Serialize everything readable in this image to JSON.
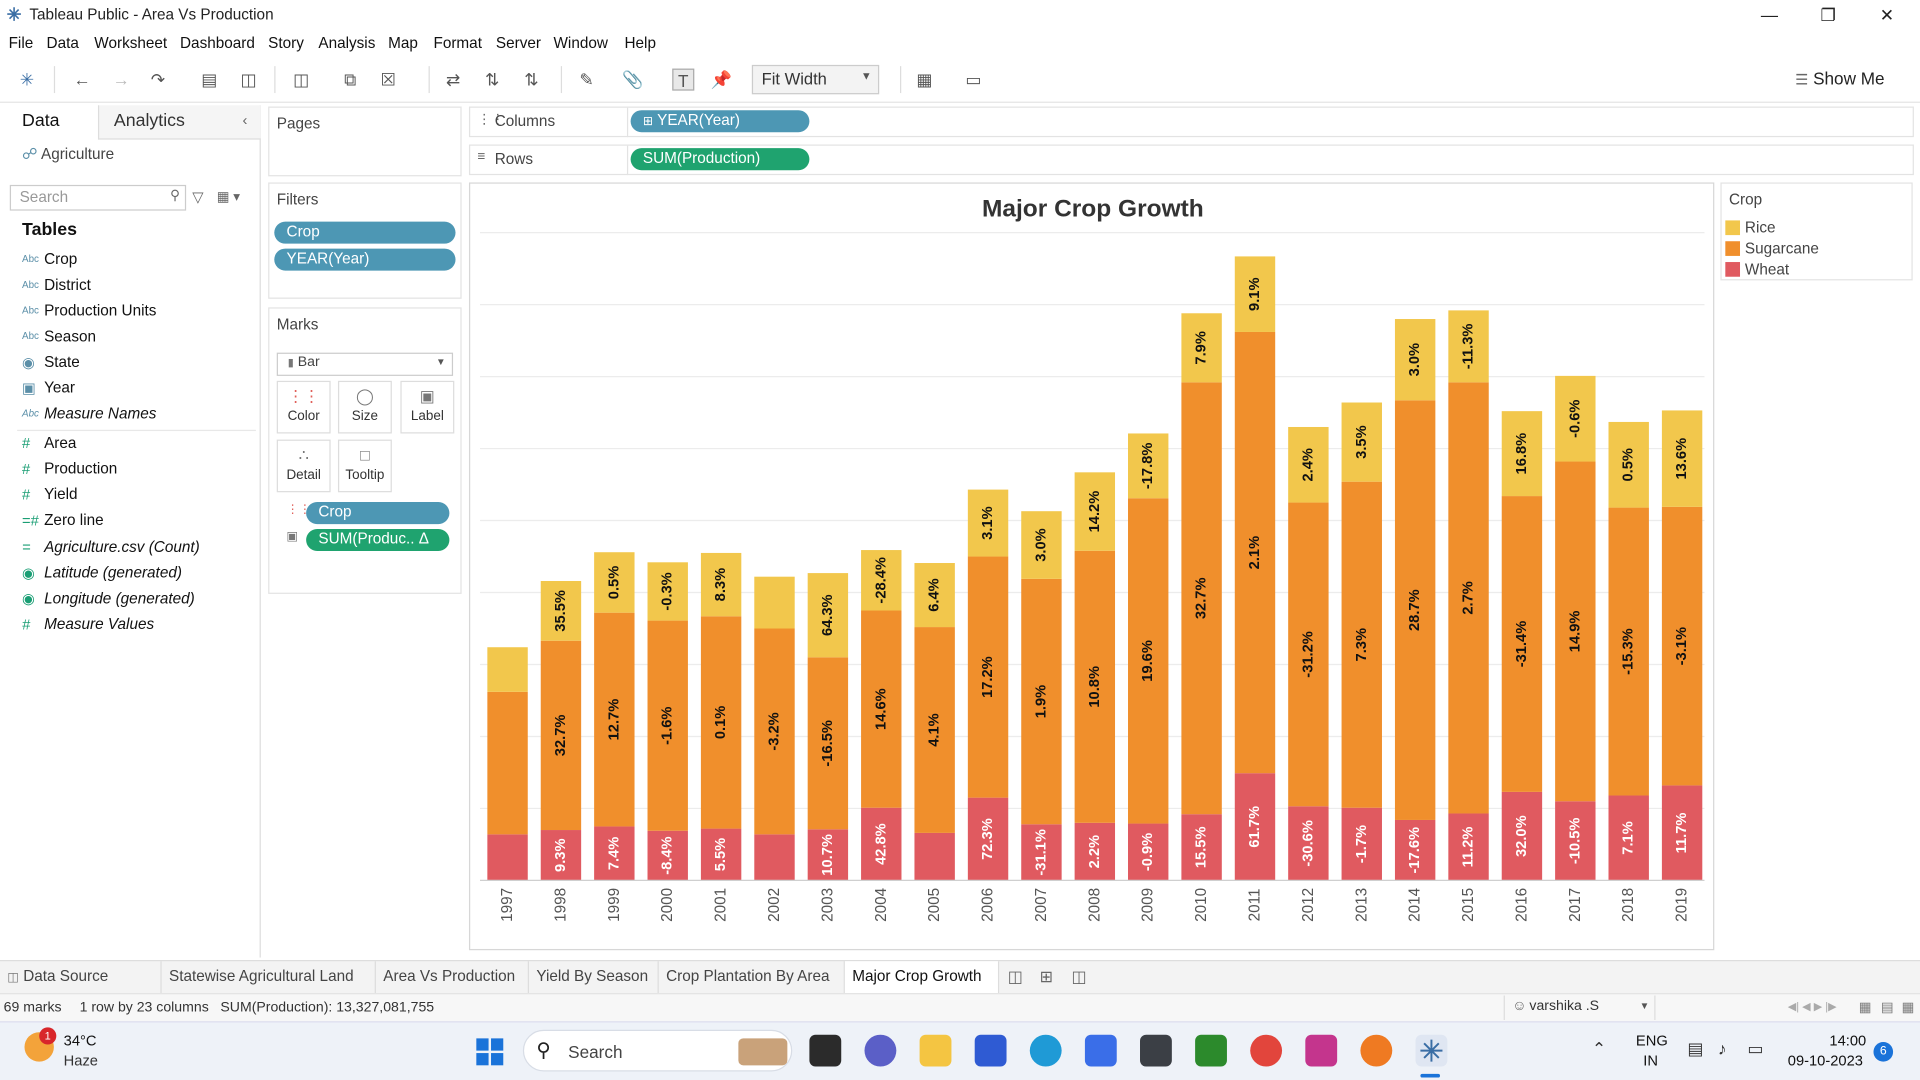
{
  "window": {
    "title": "Tableau Public - Area Vs Production"
  },
  "menu": [
    "File",
    "Data",
    "Worksheet",
    "Dashboard",
    "Story",
    "Analysis",
    "Map",
    "Format",
    "Server",
    "Window",
    "Help"
  ],
  "toolbar": {
    "fit": "Fit Width",
    "show_me": "Show Me"
  },
  "data_pane": {
    "tab_data": "Data",
    "tab_analytics": "Analytics",
    "datasource": "Agriculture",
    "search_placeholder": "Search",
    "tables_heading": "Tables",
    "dimensions": [
      {
        "icon": "Abc",
        "label": "Crop"
      },
      {
        "icon": "Abc",
        "label": "District"
      },
      {
        "icon": "Abc",
        "label": "Production Units"
      },
      {
        "icon": "Abc",
        "label": "Season"
      },
      {
        "icon": "globe",
        "label": "State"
      },
      {
        "icon": "calendar",
        "label": "Year"
      },
      {
        "icon": "Abc",
        "label": "Measure Names"
      }
    ],
    "measures": [
      {
        "label": "Area"
      },
      {
        "label": "Production"
      },
      {
        "label": "Yield"
      },
      {
        "label": "Zero line"
      },
      {
        "label": "Agriculture.csv (Count)"
      },
      {
        "label": "Latitude (generated)"
      },
      {
        "label": "Longitude (generated)"
      },
      {
        "label": "Measure Values"
      }
    ]
  },
  "pages": {
    "label": "Pages"
  },
  "filters": {
    "label": "Filters",
    "items": [
      "Crop",
      "YEAR(Year)"
    ]
  },
  "marks": {
    "label": "Marks",
    "type": "Bar",
    "buttons": [
      "Color",
      "Size",
      "Label",
      "Detail",
      "Tooltip"
    ],
    "pills": [
      "Crop",
      "SUM(Produc.. Δ"
    ]
  },
  "shelves": {
    "columns_label": "Columns",
    "columns_pill": "YEAR(Year)",
    "rows_label": "Rows",
    "rows_pill": "SUM(Production)"
  },
  "legend": {
    "title": "Crop",
    "items": [
      {
        "name": "Rice",
        "color": "#f2c74c"
      },
      {
        "name": "Sugarcane",
        "color": "#f08f2c"
      },
      {
        "name": "Wheat",
        "color": "#e05a60"
      }
    ]
  },
  "chart_data": {
    "type": "bar",
    "stacked": true,
    "title": "Major Crop Growth",
    "categories": [
      "1997",
      "1998",
      "1999",
      "2000",
      "2001",
      "2002",
      "2003",
      "2004",
      "2005",
      "2006",
      "2007",
      "2008",
      "2009",
      "2010",
      "2011",
      "2012",
      "2013",
      "2014",
      "2015",
      "2016",
      "2017",
      "2018",
      "2019"
    ],
    "series": [
      {
        "name": "Wheat",
        "color": "#e05a60",
        "values": [
          0.64,
          0.7,
          0.75,
          0.69,
          0.72,
          0.64,
          0.71,
          1.01,
          0.66,
          1.15,
          0.78,
          0.8,
          0.79,
          0.92,
          1.49,
          1.03,
          1.01,
          0.84,
          0.93,
          1.23,
          1.1,
          1.18,
          1.32
        ],
        "labels": [
          "",
          "9.3%",
          "7.4%",
          "-8.4%",
          "5.5%",
          "",
          "10.7%",
          "42.8%",
          "",
          "72.3%",
          "-31.1%",
          "2.2%",
          "-0.9%",
          "15.5%",
          "61.7%",
          "-30.6%",
          "-1.7%",
          "-17.6%",
          "11.2%",
          "32.0%",
          "-10.5%",
          "7.1%",
          "11.7%"
        ]
      },
      {
        "name": "Sugarcane",
        "color": "#f08f2c",
        "values": [
          1.98,
          2.63,
          2.97,
          2.92,
          2.95,
          2.86,
          2.39,
          2.74,
          2.86,
          3.35,
          3.41,
          3.78,
          4.52,
          6.0,
          6.13,
          4.22,
          4.53,
          5.83,
          5.99,
          4.11,
          4.72,
          4.0,
          3.87
        ],
        "labels": [
          "",
          "32.7%",
          "12.7%",
          "-1.6%",
          "0.1%",
          "-3.2%",
          "-16.5%",
          "14.6%",
          "4.1%",
          "17.2%",
          "1.9%",
          "10.8%",
          "19.6%",
          "32.7%",
          "2.1%",
          "-31.2%",
          "7.3%",
          "28.7%",
          "2.7%",
          "-31.4%",
          "14.9%",
          "-15.3%",
          "-3.1%"
        ]
      },
      {
        "name": "Rice",
        "color": "#f2c74c",
        "values": [
          0.62,
          0.83,
          0.84,
          0.81,
          0.88,
          0.72,
          1.17,
          0.84,
          0.89,
          0.93,
          0.94,
          1.09,
          0.9,
          0.96,
          1.05,
          1.05,
          1.1,
          1.13,
          1.0,
          1.18,
          1.19,
          1.19,
          1.34
        ],
        "labels": [
          "",
          "35.5%",
          "0.5%",
          "-0.3%",
          "8.3%",
          "",
          "64.3%",
          "-28.4%",
          "6.4%",
          "3.1%",
          "3.0%",
          "14.2%",
          "-17.8%",
          "7.9%",
          "9.1%",
          "2.4%",
          "3.5%",
          "3.0%",
          "-11.3%",
          "16.8%",
          "-0.6%",
          "0.5%",
          "13.6%"
        ]
      }
    ],
    "y_max": 9.0,
    "grid": true,
    "legend_position": "right"
  },
  "sheet_tabs": {
    "data_source": "Data Source",
    "sheets": [
      "Statewise Agricultural Land",
      "Area Vs Production",
      "Yield By Season",
      "Crop Plantation By Area",
      "Major Crop Growth"
    ],
    "active": "Major Crop Growth"
  },
  "status": {
    "marks": "69 marks",
    "layout": "1 row by 23 columns",
    "sum": "SUM(Production): 13,327,081,755",
    "user": "varshika .S"
  },
  "taskbar": {
    "weather_temp": "34°C",
    "weather_desc": "Haze",
    "weather_badge": "1",
    "search": "Search",
    "lang1": "ENG",
    "lang2": "IN",
    "time": "14:00",
    "date": "09-10-2023",
    "notif": "6"
  }
}
